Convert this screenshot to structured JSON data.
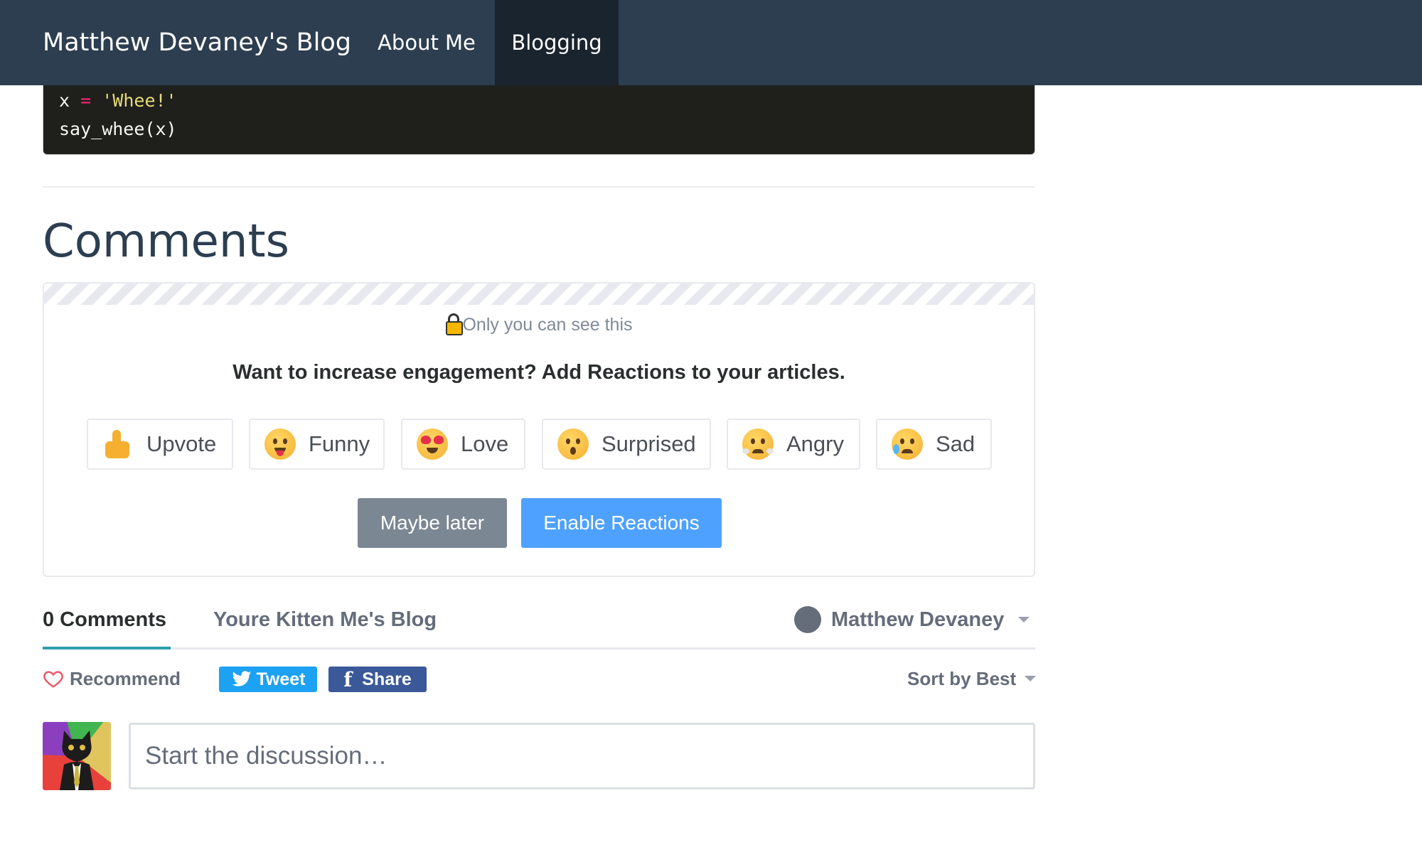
{
  "navbar": {
    "brand": "Matthew Devaney's Blog",
    "links": [
      {
        "label": "About Me",
        "active": false
      },
      {
        "label": "Blogging",
        "active": true
      }
    ]
  },
  "code": {
    "lines": [
      {
        "var": "x",
        "op": "=",
        "str": "'Whee!'"
      },
      {
        "text": "say_whee(x)"
      }
    ]
  },
  "comments": {
    "heading": "Comments"
  },
  "reactions_promo": {
    "private_note": "Only you can see this",
    "title": "Want to increase engagement? Add Reactions to your articles.",
    "reactions": [
      {
        "label": "Upvote",
        "icon": "thumbs-up-icon"
      },
      {
        "label": "Funny",
        "icon": "funny-face-icon"
      },
      {
        "label": "Love",
        "icon": "heart-eyes-icon"
      },
      {
        "label": "Surprised",
        "icon": "surprised-face-icon"
      },
      {
        "label": "Angry",
        "icon": "angry-face-icon"
      },
      {
        "label": "Sad",
        "icon": "sad-face-icon"
      }
    ],
    "maybe_later": "Maybe later",
    "enable": "Enable Reactions"
  },
  "disqus": {
    "tab_count": "0 Comments",
    "tab_community": "Youre Kitten Me's Blog",
    "user_name": "Matthew Devaney",
    "recommend": "Recommend",
    "tweet": "Tweet",
    "share": "Share",
    "sort": "Sort by Best",
    "placeholder": "Start the discussion…"
  },
  "colors": {
    "navbar": "#2c3e50",
    "navbar_active": "#1a242f",
    "accent_blue": "#4fa1ff",
    "twitter": "#1da1f2",
    "facebook": "#3b5998",
    "tab_underline": "#2e9fad"
  }
}
